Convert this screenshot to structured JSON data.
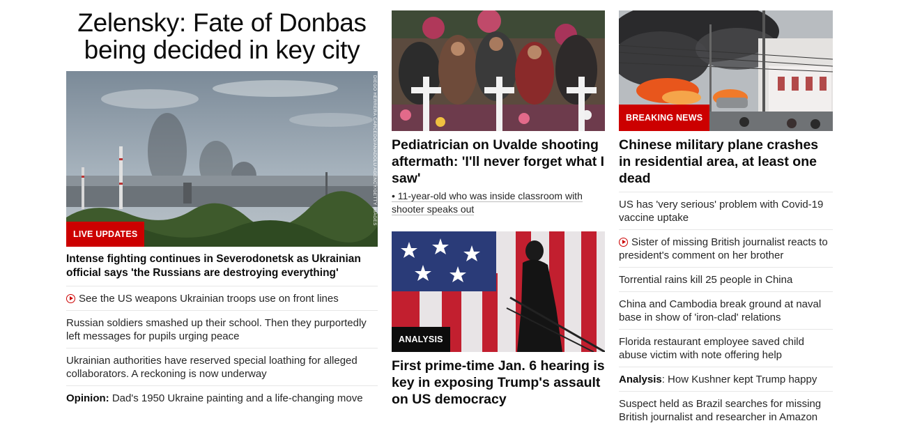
{
  "column1": {
    "headline": "Zelensky: Fate of Donbas being decided in key city",
    "badge": "LIVE UPDATES",
    "photo_credit": "DIEGO HERRERA CARCEDO/ANADOLU AGENCY/GETTY IMAGES",
    "lead": "Intense fighting continues in Severodonetsk as Ukrainian official says 'the Russians are destroying everything'",
    "items": [
      {
        "text": "See the US weapons Ukrainian troops use on front lines",
        "video": true
      },
      {
        "text": "Russian soldiers smashed up their school. Then they purportedly left messages for pupils urging peace"
      },
      {
        "text": "Ukrainian authorities have reserved special loathing for alleged collaborators. A reckoning is now underway"
      },
      {
        "prefix": "Opinion:",
        "text": " Dad's 1950 Ukraine painting and a life-changing move"
      }
    ]
  },
  "column2": {
    "story1": {
      "title": "Pediatrician on Uvalde shooting aftermath: 'I'll never forget what I saw'",
      "bullet": "• 11-year-old who was inside classroom with shooter speaks out"
    },
    "story2": {
      "badge": "ANALYSIS",
      "title": "First prime-time Jan. 6 hearing is key in exposing Trump's assault on US democracy"
    }
  },
  "column3": {
    "badge": "BREAKING NEWS",
    "title": "Chinese military plane crashes in residential area, at least one dead",
    "items": [
      {
        "text": "US has 'very serious' problem with Covid-19 vaccine uptake"
      },
      {
        "text": "Sister of missing British journalist reacts to president's comment on her brother",
        "video": true
      },
      {
        "text": "Torrential rains kill 25 people in China"
      },
      {
        "text": "China and Cambodia break ground at naval base in show of 'iron-clad' relations"
      },
      {
        "text": "Florida restaurant employee saved child abuse victim with note offering help"
      },
      {
        "prefix": "Analysis",
        "text": ": How Kushner kept Trump happy"
      },
      {
        "text": "Suspect held as Brazil searches for missing British journalist and researcher in Amazon"
      }
    ]
  },
  "colors": {
    "accent": "#cc0000",
    "dark_badge": "#0c0c0c",
    "divider": "#e6e6e6"
  }
}
